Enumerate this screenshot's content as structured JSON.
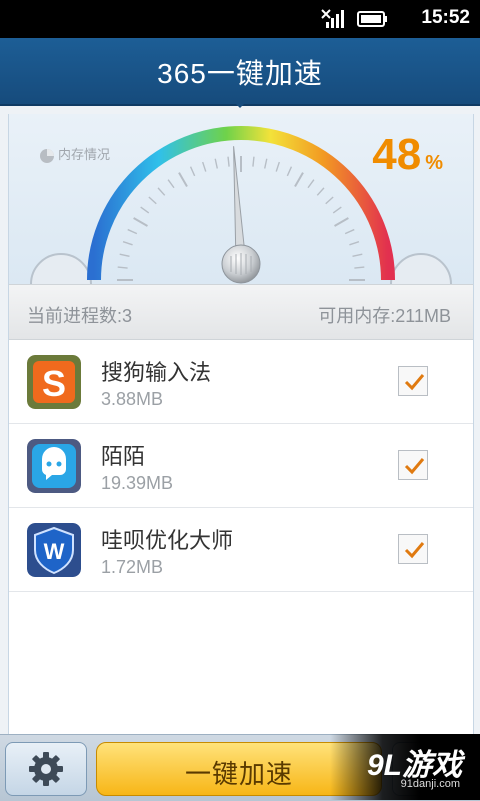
{
  "status_bar": {
    "time": "15:52",
    "icons": [
      "signal-off-icon",
      "battery-icon"
    ]
  },
  "header": {
    "title": "365一键加速"
  },
  "gauge": {
    "label": "内存情况",
    "percent": "48",
    "percent_unit": "%",
    "usage_fraction": 0.48,
    "colors": [
      "#2b6fd1",
      "#30c0ea",
      "#6fd24a",
      "#f3e23a",
      "#f29a22",
      "#e2304f"
    ]
  },
  "info_bar": {
    "process_count": "当前进程数:3",
    "available_memory": "可用内存:211MB"
  },
  "apps": [
    {
      "name": "搜狗输入法",
      "size": "3.88MB",
      "icon": "sogou-icon",
      "checked": true
    },
    {
      "name": "陌陌",
      "size": "19.39MB",
      "icon": "momo-icon",
      "checked": true
    },
    {
      "name": "哇呗优化大师",
      "size": "1.72MB",
      "icon": "wabei-shield-icon",
      "checked": true
    }
  ],
  "bottom_bar": {
    "boost_label": "一键加速",
    "settings_icon": "gear-icon"
  },
  "watermark": {
    "logo": "9L游戏",
    "url": "91danji.com"
  },
  "colors": {
    "accent_orange": "#f08c00",
    "header_blue": "#1d5e96",
    "check_orange": "#e07a10"
  }
}
